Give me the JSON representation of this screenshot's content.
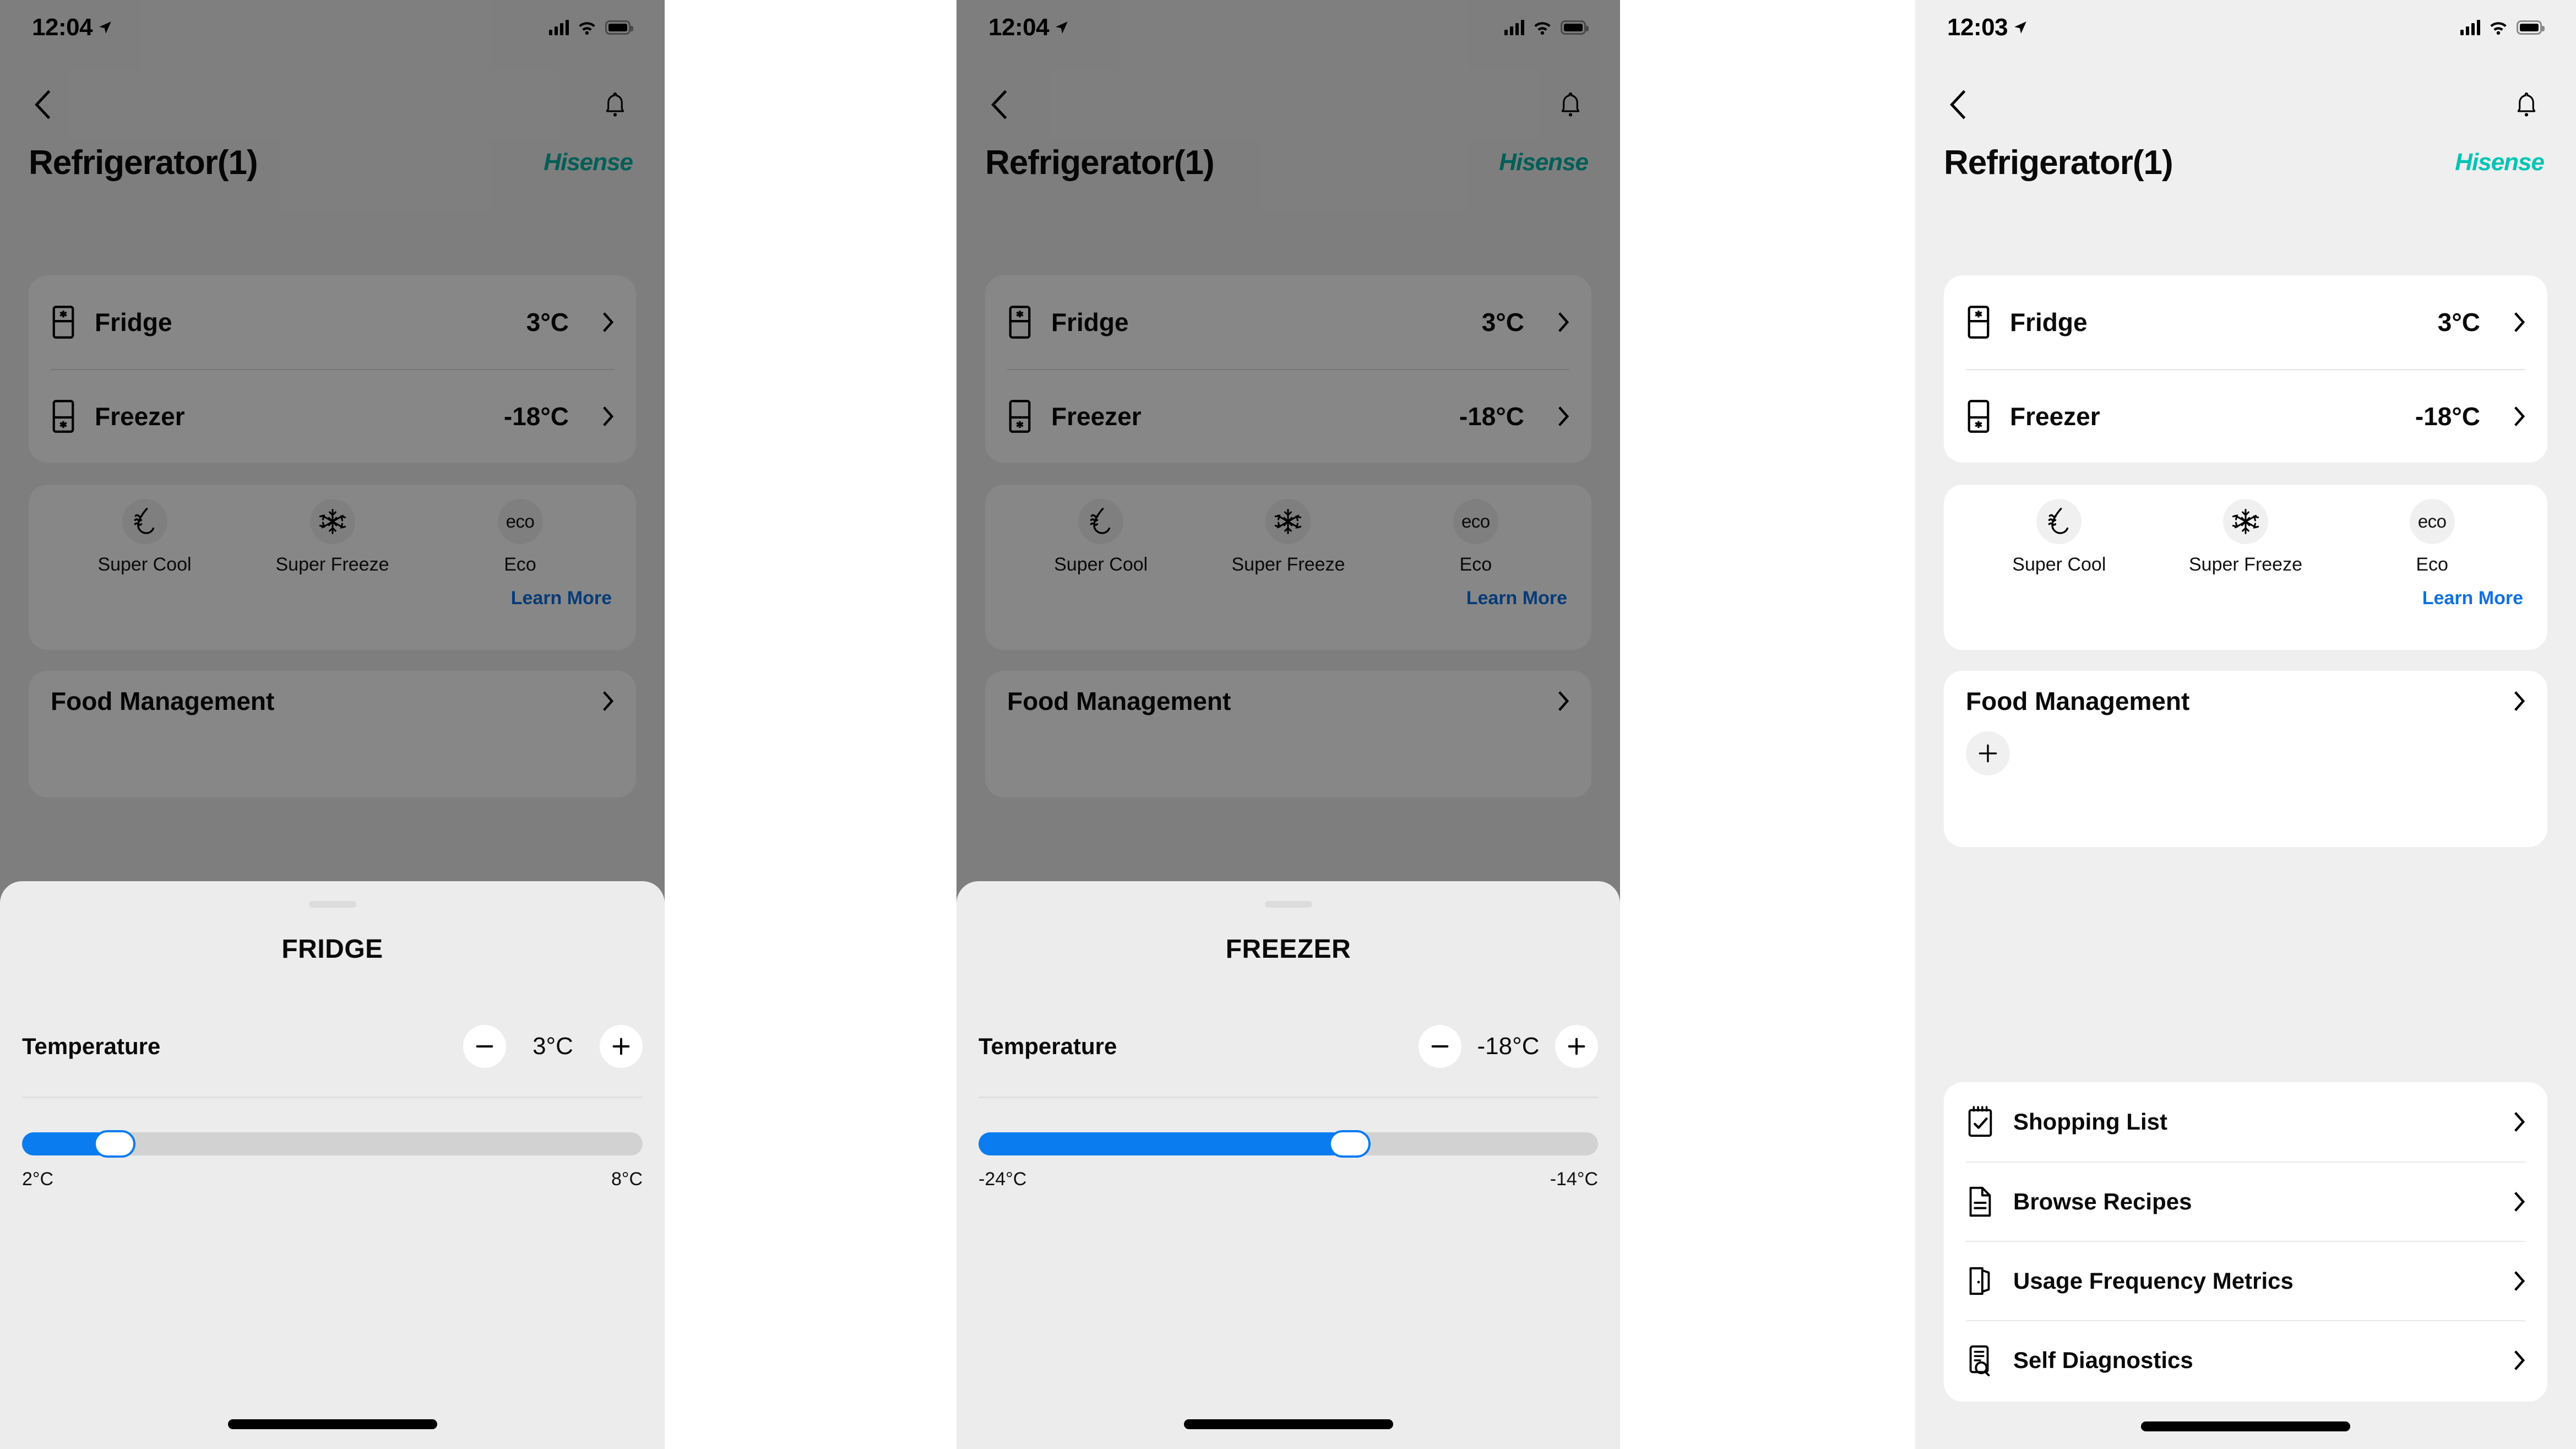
{
  "brand": {
    "name": "Hisense",
    "color": "#00b3a4"
  },
  "accent": {
    "blue": "#0a7cf0",
    "link": "#1070e0"
  },
  "panels": [
    {
      "status": {
        "time": "12:04",
        "location_icon": "location-arrow-icon",
        "signal_icon": "cellular-signal-icon",
        "wifi_icon": "wifi-icon",
        "battery_icon": "battery-full-icon"
      },
      "nav": {
        "back_icon": "chevron-left-icon",
        "bell_icon": "notification-bell-icon"
      },
      "header": {
        "title": "Refrigerator(1)"
      },
      "compartments": [
        {
          "name": "Fridge",
          "value": "3°C",
          "icon": "fridge-compartment-icon"
        },
        {
          "name": "Freezer",
          "value": "-18°C",
          "icon": "freezer-compartment-icon"
        }
      ],
      "modes": [
        {
          "label": "Super Cool",
          "icon": "water-drop-cool-icon"
        },
        {
          "label": "Super Freeze",
          "icon": "snowflake-icon"
        },
        {
          "label": "Eco",
          "icon": "eco-text-icon",
          "glyph": "eco"
        }
      ],
      "learn_more": "Learn More",
      "food": {
        "title": "Food Management",
        "chevron": "chevron-right-icon"
      },
      "sheet": {
        "title": "FRIDGE",
        "temperature_label": "Temperature",
        "value": "3°C",
        "minus_label": "−",
        "plus_label": "+",
        "range_min": "2°C",
        "range_max": "8°C",
        "fill_percent": 17
      }
    },
    {
      "status": {
        "time": "12:04"
      },
      "header": {
        "title": "Refrigerator(1)"
      },
      "compartments": [
        {
          "name": "Fridge",
          "value": "3°C"
        },
        {
          "name": "Freezer",
          "value": "-18°C"
        }
      ],
      "modes": [
        {
          "label": "Super Cool"
        },
        {
          "label": "Super Freeze"
        },
        {
          "label": "Eco",
          "glyph": "eco"
        }
      ],
      "learn_more": "Learn More",
      "food": {
        "title": "Food Management"
      },
      "sheet": {
        "title": "FREEZER",
        "temperature_label": "Temperature",
        "value": "-18°C",
        "minus_label": "−",
        "plus_label": "+",
        "range_min": "-24°C",
        "range_max": "-14°C",
        "fill_percent": 62
      }
    },
    {
      "status": {
        "time": "12:03"
      },
      "header": {
        "title": "Refrigerator(1)"
      },
      "compartments": [
        {
          "name": "Fridge",
          "value": "3°C"
        },
        {
          "name": "Freezer",
          "value": "-18°C"
        }
      ],
      "modes": [
        {
          "label": "Super Cool"
        },
        {
          "label": "Super Freeze"
        },
        {
          "label": "Eco",
          "glyph": "eco"
        }
      ],
      "learn_more": "Learn More",
      "food": {
        "title": "Food Management",
        "add_label": "+"
      },
      "list": [
        {
          "label": "Shopping List",
          "icon": "notepad-check-icon"
        },
        {
          "label": "Browse Recipes",
          "icon": "document-lines-icon"
        },
        {
          "label": "Usage Frequency Metrics",
          "icon": "open-door-icon"
        },
        {
          "label": "Self Diagnostics",
          "icon": "diagnostics-stethoscope-icon"
        }
      ]
    }
  ]
}
